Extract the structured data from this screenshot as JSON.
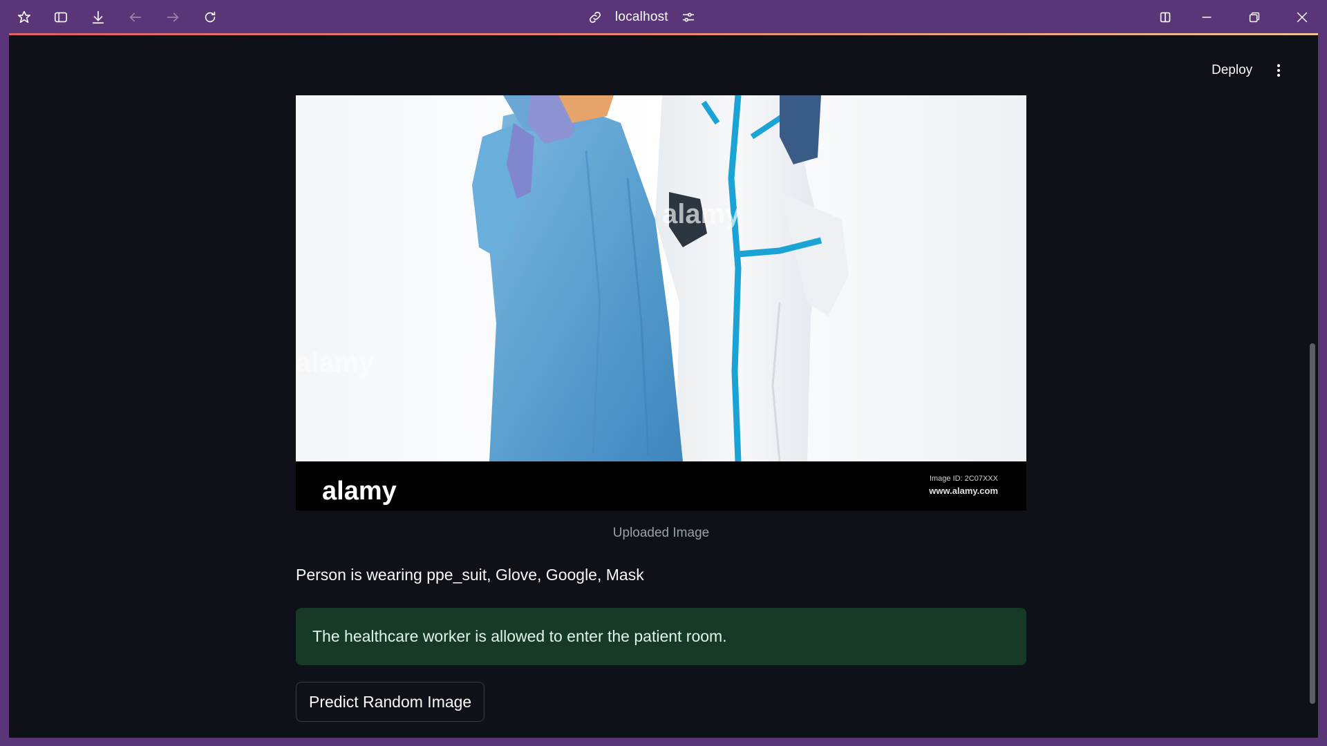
{
  "browser": {
    "url": "localhost",
    "icons": [
      "app-logo-icon",
      "sidebar-toggle-icon",
      "download-icon",
      "back-arrow-icon",
      "forward-arrow-icon",
      "reload-icon",
      "link-icon",
      "site-settings-icon",
      "split-view-icon",
      "minimize-icon",
      "restore-icon",
      "close-icon"
    ]
  },
  "header": {
    "deploy_label": "Deploy"
  },
  "image": {
    "caption": "Uploaded Image",
    "watermark_center": "alamy",
    "watermark_left": "alamy",
    "footer_logo": "alamy",
    "footer_id": "Image ID: 2C07XXX",
    "footer_site": "www.alamy.com"
  },
  "result": {
    "prediction_text": "Person is wearing ppe_suit, Glove, Google, Mask",
    "status_message": "The healthcare worker is allowed to enter the patient room."
  },
  "actions": {
    "predict_button_label": "Predict Random Image"
  },
  "colors": {
    "window_frame": "#5a3577",
    "app_background": "#0e1117",
    "success_background": "#173928",
    "text": "#fafafa"
  }
}
